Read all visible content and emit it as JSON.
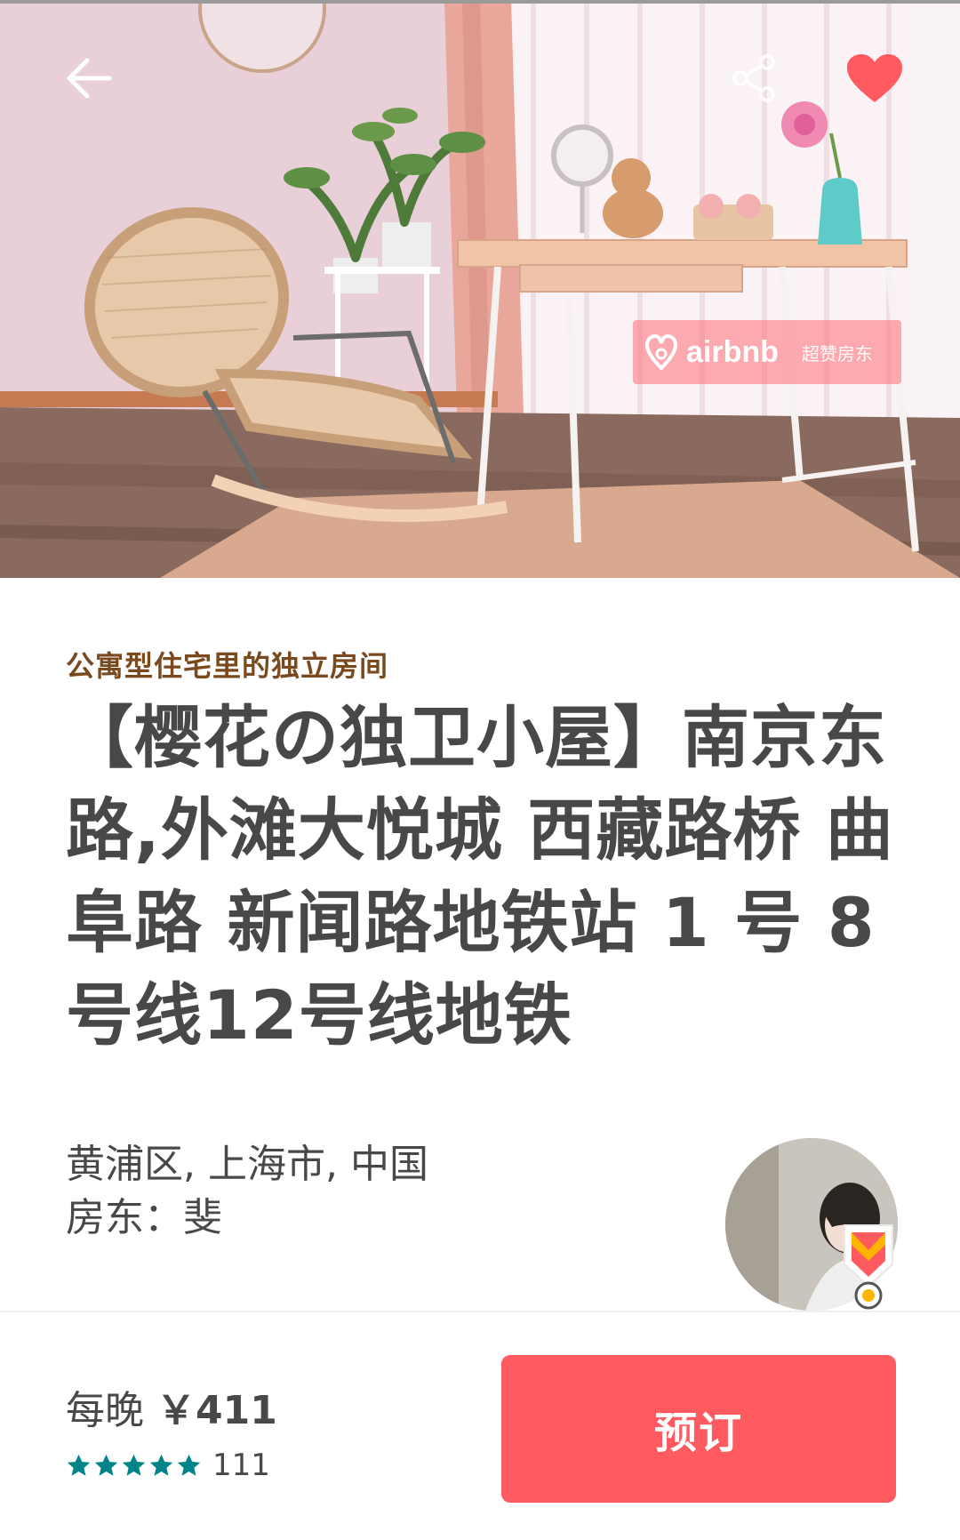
{
  "hero": {
    "watermark_brand": "airbnb",
    "watermark_sub": "超赞房东"
  },
  "listing": {
    "room_type": "公寓型住宅里的独立房间",
    "title": "【樱花の独卫小屋】南京东路,外滩大悦城 西藏路桥 曲阜路 新闻路地铁站 1 号 8号线12号线地铁",
    "location": "黄浦区, 上海市, 中国",
    "host": "房东：斐"
  },
  "booking": {
    "price_prefix": "每晚",
    "price_amount": "￥411",
    "star_rating": 5,
    "review_count": "111",
    "book_label": "预订"
  },
  "colors": {
    "brand": "#ff5a5f",
    "room_type": "#7a4a1e",
    "star": "#008489",
    "text": "#484848"
  },
  "icons": {
    "back": "arrow-left-icon",
    "share": "share-icon",
    "favorite": "heart-icon",
    "star": "star-icon",
    "superhost": "superhost-badge-icon"
  }
}
